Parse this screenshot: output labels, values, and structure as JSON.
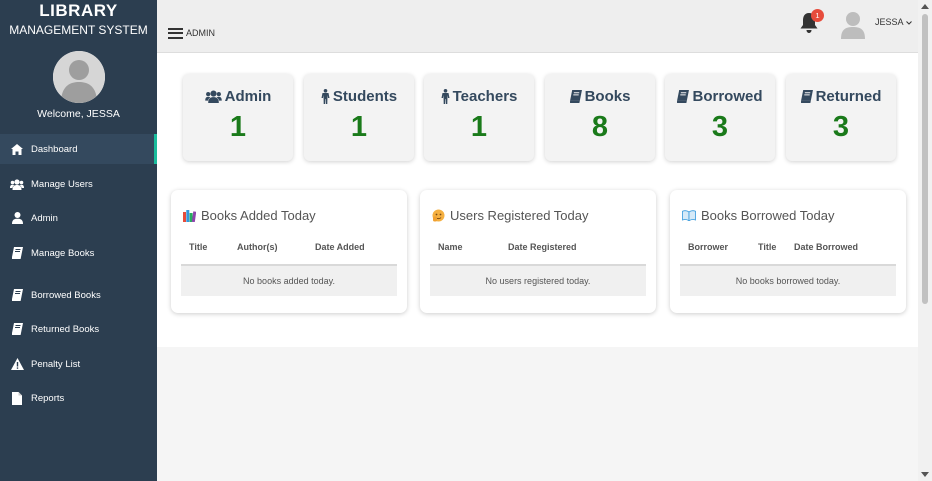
{
  "sidebar": {
    "title": "LIBRARY",
    "subtitle": "MANAGEMENT SYSTEM",
    "welcome": "Welcome, JESSA",
    "items": [
      {
        "label": "Dashboard",
        "icon": "home-icon",
        "active": true
      },
      {
        "label": "Manage Users",
        "icon": "users-icon"
      },
      {
        "label": "Admin",
        "icon": "user-icon"
      },
      {
        "label": "Manage Books",
        "icon": "book-icon"
      },
      {
        "label": "Borrowed Books",
        "icon": "book-icon"
      },
      {
        "label": "Returned Books",
        "icon": "book-icon"
      },
      {
        "label": "Penalty List",
        "icon": "warning-icon"
      },
      {
        "label": "Reports",
        "icon": "file-icon"
      }
    ]
  },
  "topbar": {
    "menu_label": "ADMIN",
    "notification_count": "1",
    "user_name": "JESSA"
  },
  "stats": [
    {
      "label": "Admin",
      "value": "1",
      "icon": "users-icon"
    },
    {
      "label": "Students",
      "value": "1",
      "icon": "male-icon"
    },
    {
      "label": "Teachers",
      "value": "1",
      "icon": "male-icon"
    },
    {
      "label": "Books",
      "value": "8",
      "icon": "book-icon"
    },
    {
      "label": "Borrowed",
      "value": "3",
      "icon": "book-icon"
    },
    {
      "label": "Returned",
      "value": "3",
      "icon": "book-icon"
    }
  ],
  "panels": [
    {
      "title": "Books Added Today",
      "icon": "books-icon",
      "columns": [
        "Title",
        "Author(s)",
        "Date Added"
      ],
      "empty": "No books added today."
    },
    {
      "title": "Users Registered Today",
      "icon": "face-icon",
      "columns": [
        "Name",
        "Date Registered"
      ],
      "empty": "No users registered today."
    },
    {
      "title": "Books Borrowed Today",
      "icon": "open-book-icon",
      "columns": [
        "Borrower",
        "Title",
        "Date Borrowed"
      ],
      "empty": "No books borrowed today."
    }
  ],
  "colors": {
    "sidebar": "#2c3e50",
    "active_accent": "#1abc9c",
    "stat_value": "#1a7a1a",
    "badge": "#e74c3c"
  }
}
